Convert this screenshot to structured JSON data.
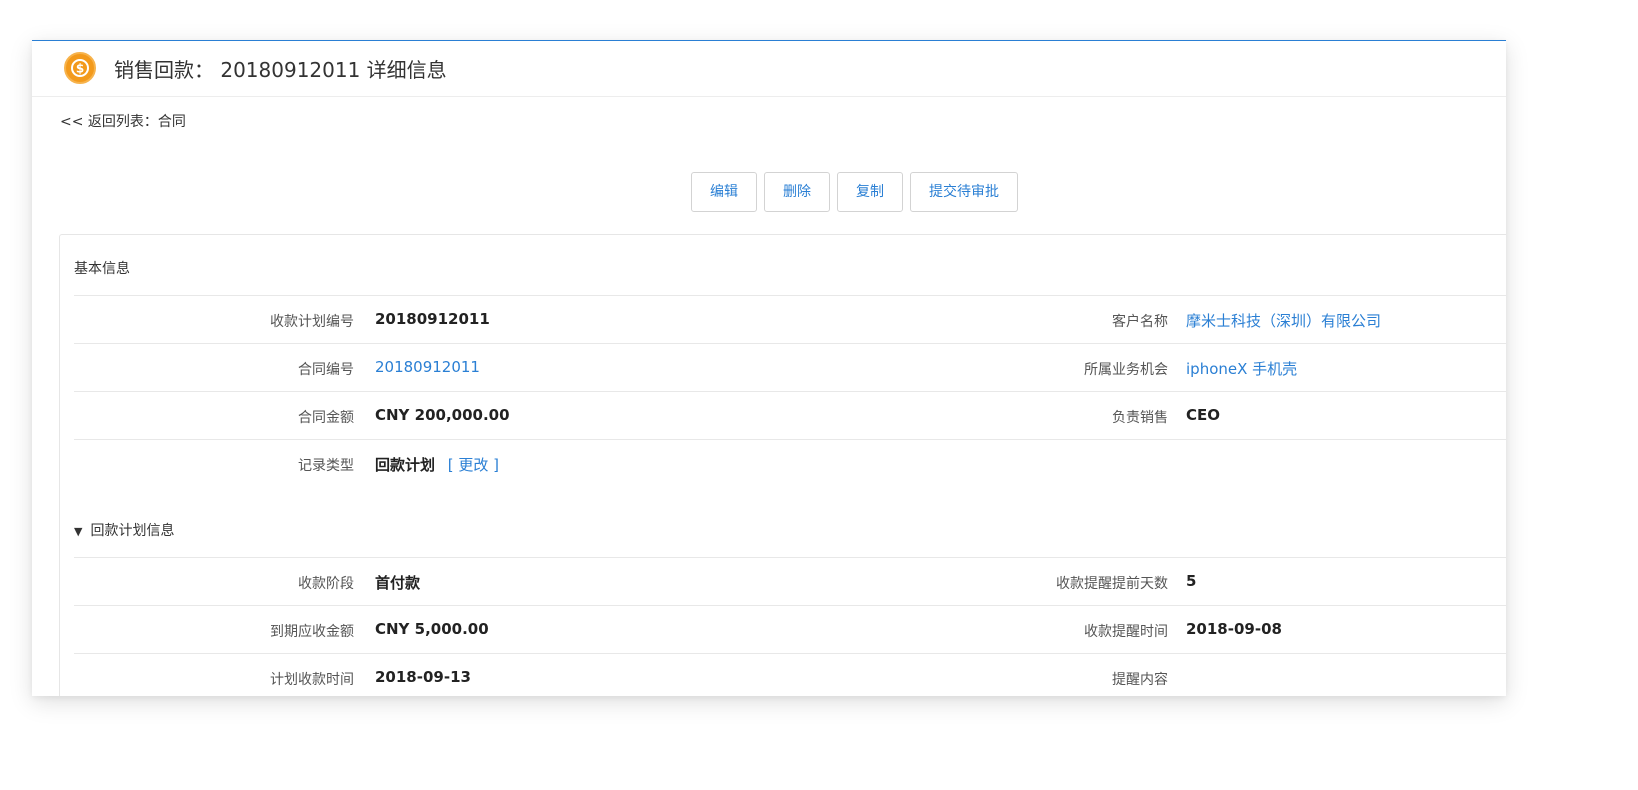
{
  "header": {
    "icon": "coin-dollar-icon",
    "title": "销售回款： 20180912011  详细信息"
  },
  "nav": {
    "back_label": "<< 返回列表：合同"
  },
  "toolbar": {
    "edit": "编辑",
    "delete": "删除",
    "copy": "复制",
    "submit": "提交待审批"
  },
  "basic": {
    "title": "基本信息",
    "plan_no_label": "收款计划编号",
    "plan_no": "20180912011",
    "customer_label": "客户名称",
    "customer": "摩米士科技（深圳）有限公司",
    "contract_no_label": "合同编号",
    "contract_no": "20180912011",
    "opportunity_label": "所属业务机会",
    "opportunity": "iphoneX 手机壳",
    "amount_label": "合同金额",
    "amount": "CNY 200,000.00",
    "owner_label": "负责销售",
    "owner": "CEO",
    "record_type_label": "记录类型",
    "record_type": "回款计划",
    "change_link": "[ 更改 ]"
  },
  "plan": {
    "toggle_symbol": "▼",
    "title": "回款计划信息",
    "stage_label": "收款阶段",
    "stage": "首付款",
    "remind_days_label": "收款提醒提前天数",
    "remind_days": "5",
    "due_amount_label": "到期应收金额",
    "due_amount": "CNY 5,000.00",
    "remind_time_label": "收款提醒时间",
    "remind_time": "2018-09-08",
    "plan_time_label": "计划收款时间",
    "plan_time": "2018-09-13",
    "remind_content_label": "提醒内容",
    "remind_content": ""
  },
  "colors": {
    "accent": "#2a7fd4",
    "icon": "#f39a1c"
  }
}
